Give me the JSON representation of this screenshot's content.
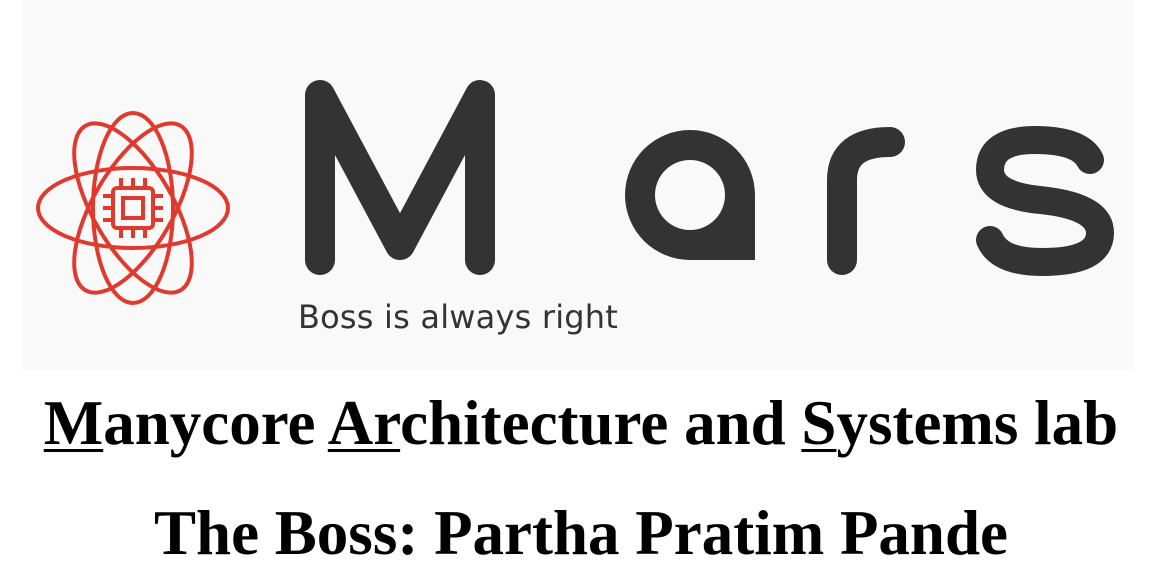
{
  "logo": {
    "wordmark": "Mars",
    "tagline": "Boss is always right",
    "icon": "atom-chip-icon",
    "colors": {
      "accent": "#e03a2f",
      "wordmark": "#333333"
    }
  },
  "title": {
    "part1_underlined": "M",
    "part2": "anycore ",
    "part3_underlined": "Ar",
    "part4": "chitecture and ",
    "part5_underlined": "S",
    "part6": "ystems lab"
  },
  "boss_line": "The Boss: Partha Pratim Pande"
}
